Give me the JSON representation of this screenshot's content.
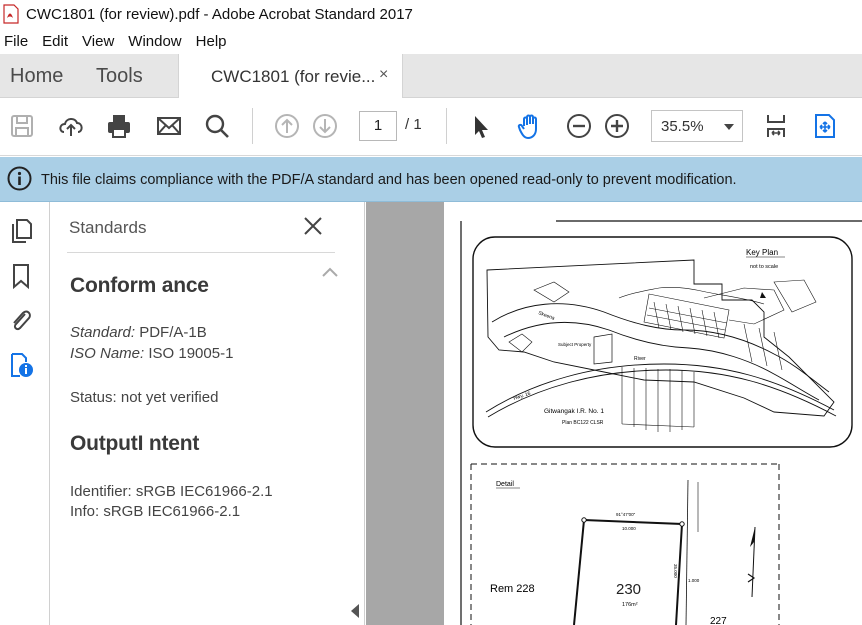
{
  "window": {
    "title": "CWC1801 (for review).pdf - Adobe Acrobat Standard 2017"
  },
  "menu": [
    "File",
    "Edit",
    "View",
    "Window",
    "Help"
  ],
  "tabs": {
    "home": "Home",
    "tools": "Tools",
    "document": "CWC1801 (for revie...",
    "close": "×"
  },
  "toolbar": {
    "page_current": "1",
    "page_total": "/ 1",
    "zoom": "35.5%",
    "icons": [
      "save-icon",
      "cloud-upload-icon",
      "print-icon",
      "email-icon",
      "search-icon",
      "page-up-icon",
      "page-down-icon",
      "select-cursor-icon",
      "hand-icon",
      "zoom-out-icon",
      "zoom-in-icon",
      "fit-page-icon",
      "full-screen-icon"
    ]
  },
  "infobar": {
    "message": "This file claims compliance with the PDF/A standard and has been opened read-only to prevent modification."
  },
  "panel": {
    "title": "Standards",
    "conformance_heading": "Conform ance",
    "standard_label": "Standard:",
    "standard_value": "PDF/A-1B",
    "iso_label": "ISO Name:",
    "iso_value": "ISO 19005-1",
    "status": "Status: not yet verified",
    "output_heading": "OutputI ntent",
    "identifier": "Identifier: sRGB IEC61966-2.1",
    "info": "Info: sRGB IEC61966-2.1"
  },
  "document": {
    "key_plan_title": "Key Plan",
    "key_plan_subtitle": "not to scale",
    "reserve_name": "Gitwangak I.R. No. 1",
    "plan_ref": "Plan BC122 CLSR",
    "subject_property": "Subject Property",
    "river_label": "River",
    "highway_label": "Hwy. 16",
    "detail_label": "Detail",
    "lot_number": "230",
    "lot_area": "176m²",
    "neighbour_label": "Rem 228",
    "lot_227": "227",
    "bearing_top": "91°47'00\"",
    "dim_top": "10.000",
    "dim_right": "35.000",
    "dim_offset": "1.000"
  },
  "colors": {
    "accent": "#1473e6",
    "infobar": "#aacfe6",
    "tabbar": "#e6e6e6",
    "canvas": "#a7a7a7"
  }
}
